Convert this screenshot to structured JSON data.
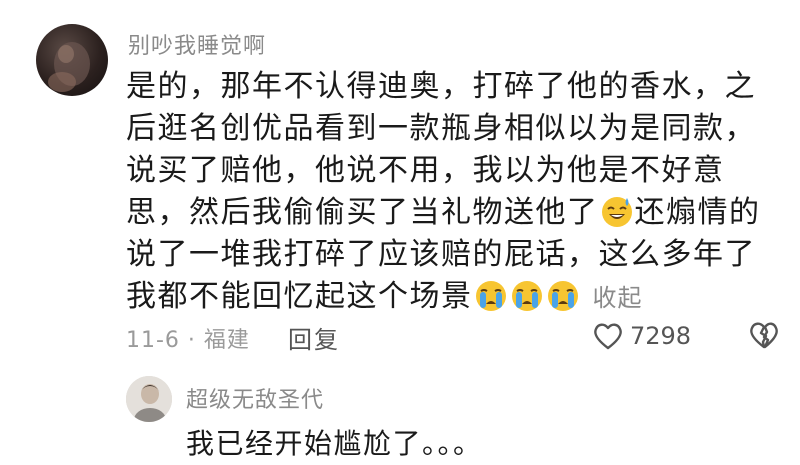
{
  "comment": {
    "username": "别吵我睡觉啊",
    "avatar": "user-avatar",
    "lines": [
      "是的，那年不认得迪奥，打碎了他的香水，之",
      "后逛名创优品看到一款瓶身相似以为是同款，",
      "说买了赔他，他说不用，我以为他是不好意",
      "思，然后我偷偷买了当礼物送他了",
      "还煽情的",
      "说了一堆我打碎了应该赔的屁话，这么多年了",
      "我都不能回忆起这个场景"
    ],
    "emoji_after_line4": "sweat-smile-emoji",
    "emoji_after_line7": [
      "crying-emoji",
      "crying-emoji",
      "crying-emoji"
    ],
    "collapse_label": "收起",
    "date_location": "11-6 · 福建",
    "reply_label": "回复",
    "like_count": "7298",
    "like_icon": "heart-outline-icon",
    "dislike_icon": "broken-heart-icon"
  },
  "reply": {
    "username": "超级无敌圣代",
    "avatar": "user-avatar",
    "text": "我已经开始尴尬了。。。"
  },
  "colors": {
    "text_primary": "#1a1a1a",
    "text_secondary": "#8a8a8a",
    "emoji_yellow": "#f7c531",
    "emoji_tear": "#4aa3e8"
  }
}
